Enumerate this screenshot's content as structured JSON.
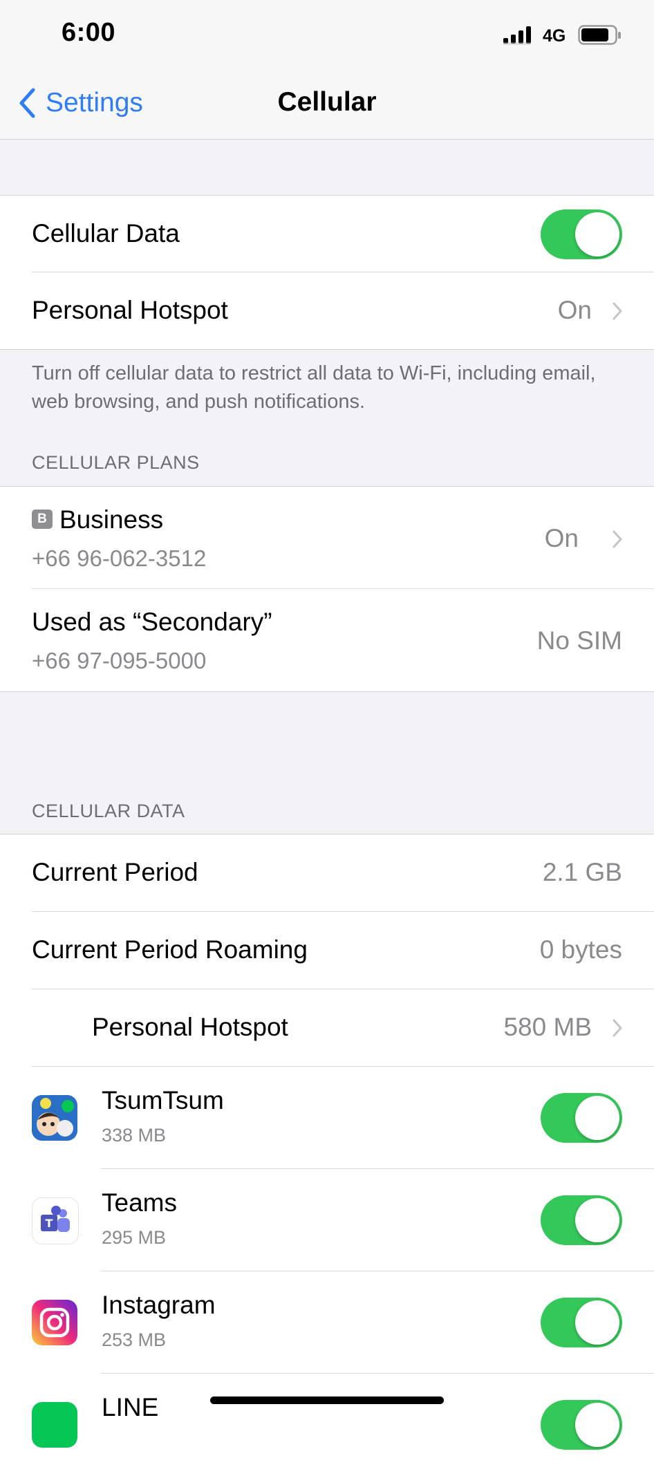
{
  "status_bar": {
    "time": "6:00",
    "network": "4G"
  },
  "nav": {
    "back_label": "Settings",
    "title": "Cellular"
  },
  "top_group": {
    "cellular_data": {
      "label": "Cellular Data",
      "enabled": true
    },
    "personal_hotspot": {
      "label": "Personal Hotspot",
      "value": "On"
    },
    "footer": "Turn off cellular data to restrict all data to Wi-Fi, including email, web browsing, and push notifications."
  },
  "plans": {
    "header": "CELLULAR PLANS",
    "business": {
      "badge": "B",
      "label": "Business",
      "number": "+66 96-062-3512",
      "value": "On"
    },
    "secondary": {
      "label": "Used as “Secondary”",
      "number": "+66 97-095-5000",
      "value": "No SIM"
    }
  },
  "usage": {
    "header": "CELLULAR DATA",
    "current_period": {
      "label": "Current Period",
      "value": "2.1 GB"
    },
    "current_roaming": {
      "label": "Current Period Roaming",
      "value": "0 bytes"
    },
    "hotspot": {
      "label": "Personal Hotspot",
      "value": "580 MB"
    },
    "apps": [
      {
        "name": "TsumTsum",
        "usage": "338 MB",
        "enabled": true,
        "icon": "tsumtsum-icon"
      },
      {
        "name": "Teams",
        "usage": "295 MB",
        "enabled": true,
        "icon": "teams-icon"
      },
      {
        "name": "Instagram",
        "usage": "253 MB",
        "enabled": true,
        "icon": "instagram-icon"
      },
      {
        "name": "LINE",
        "usage": "",
        "enabled": true,
        "icon": "line-icon"
      }
    ]
  },
  "colors": {
    "accent": "#2f7cf6",
    "toggle_on": "#34c759",
    "background": "#f2f2f7"
  }
}
